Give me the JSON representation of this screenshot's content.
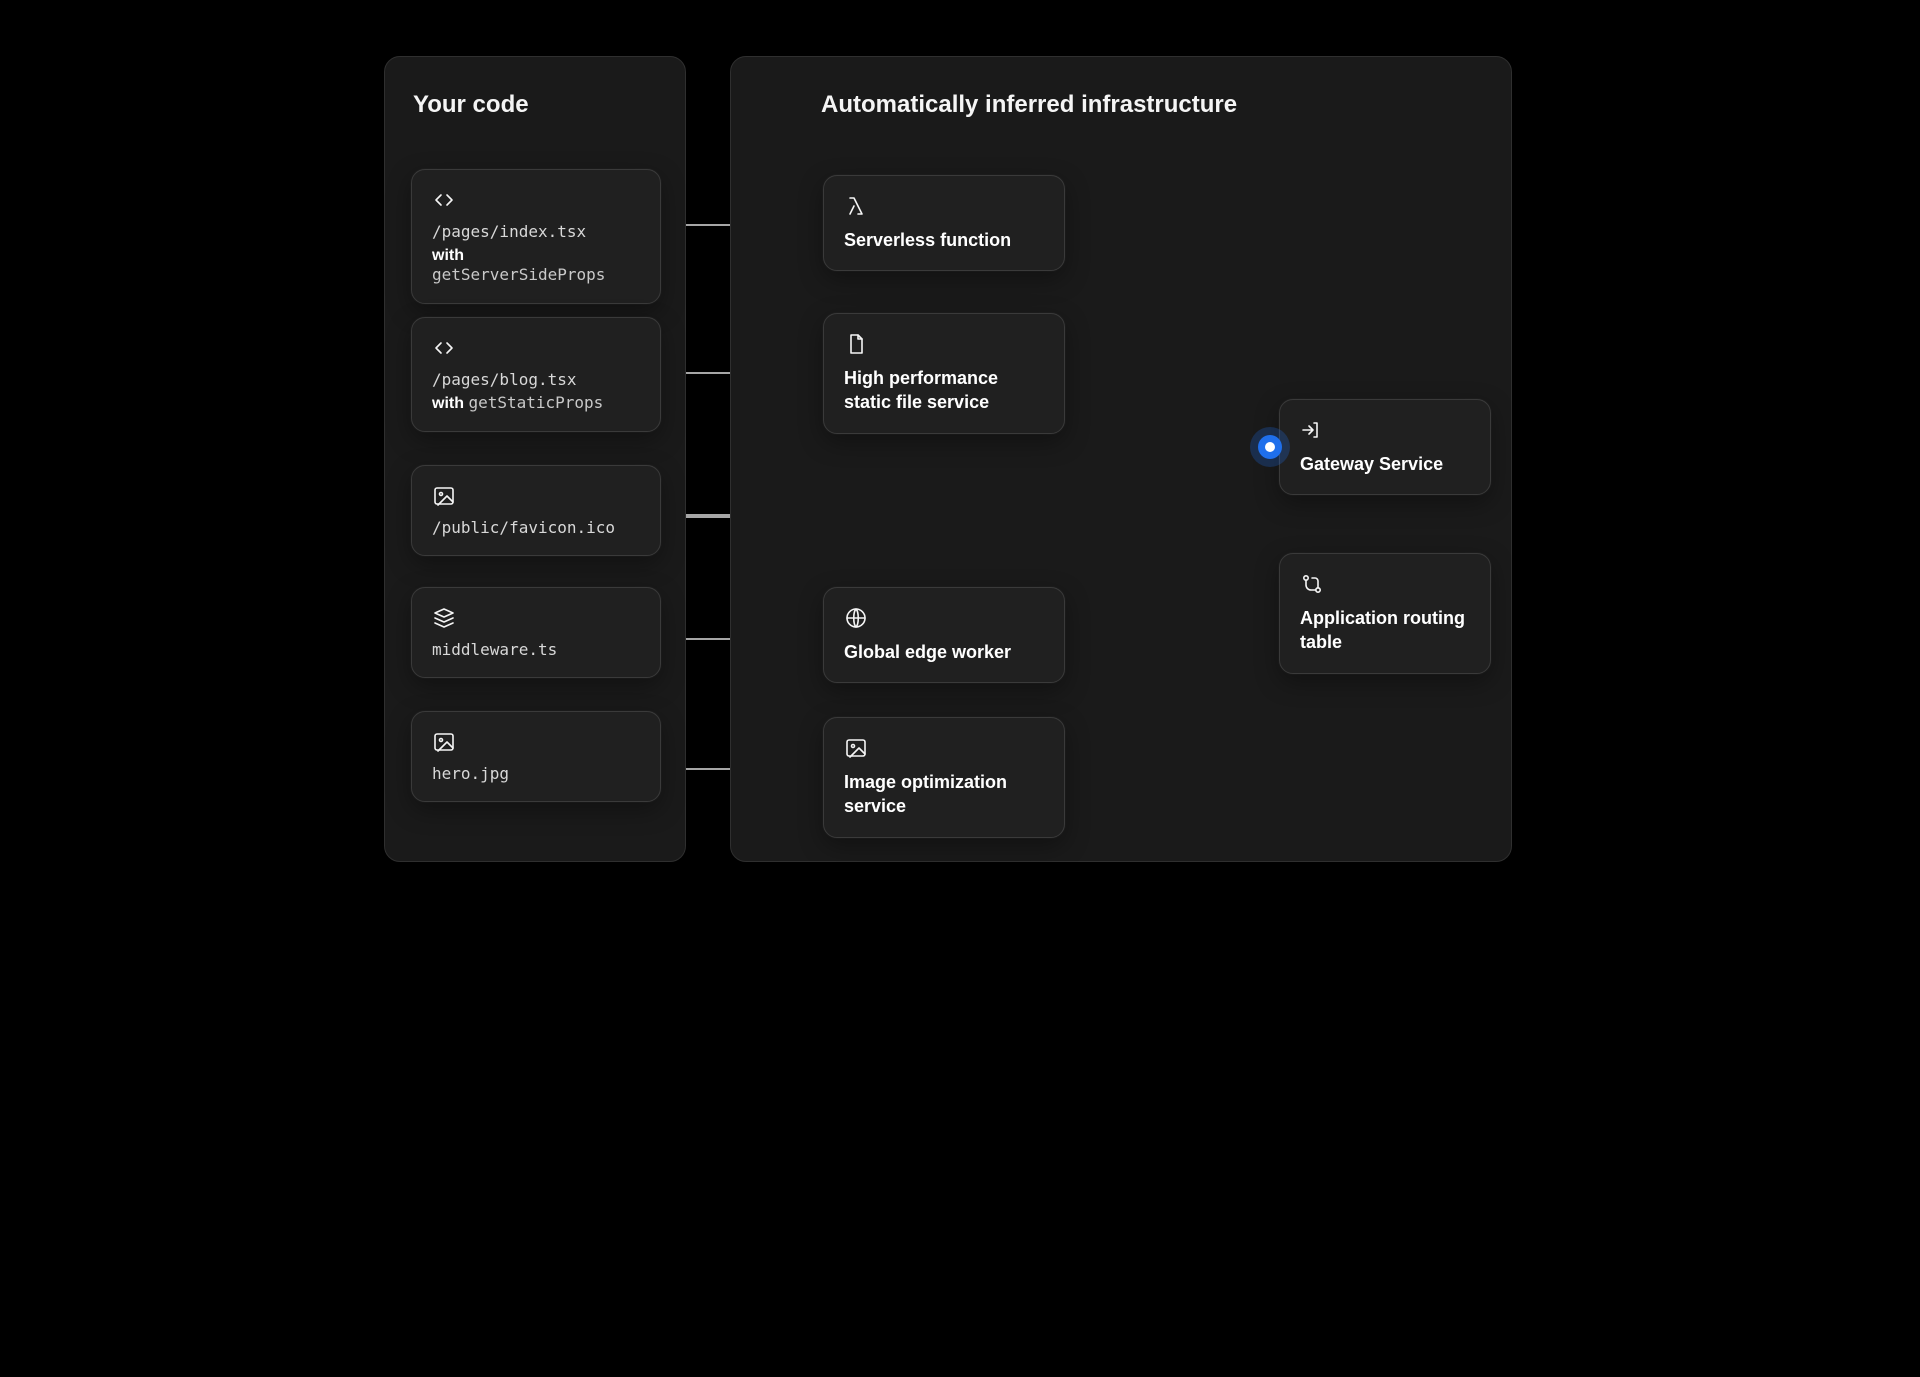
{
  "left": {
    "title": "Your code",
    "items": [
      {
        "icon": "code-icon",
        "path": "/pages/index.tsx",
        "with_label": "with",
        "hook": "getServerSideProps"
      },
      {
        "icon": "code-icon",
        "path": "/pages/blog.tsx",
        "with_label": "with",
        "hook": "getStaticProps"
      },
      {
        "icon": "image-icon",
        "path": "/public/favicon.ico"
      },
      {
        "icon": "layers-icon",
        "path": "middleware.ts"
      },
      {
        "icon": "image-icon",
        "path": "hero.jpg"
      }
    ]
  },
  "right": {
    "title": "Automatically inferred infrastructure",
    "middle": [
      {
        "icon": "lambda-icon",
        "label": "Serverless function"
      },
      {
        "icon": "file-icon",
        "label": "High performance static file service"
      },
      {
        "icon": "globe-icon",
        "label": "Global edge worker"
      },
      {
        "icon": "image-icon",
        "label": "Image optimization service"
      }
    ],
    "gateway": {
      "icon": "gateway-icon",
      "label": "Gateway Service"
    },
    "routing": {
      "icon": "routing-icon",
      "label": "Application routing table"
    }
  },
  "colors": {
    "accent": "#1f6feb",
    "line": "#dddddd"
  }
}
